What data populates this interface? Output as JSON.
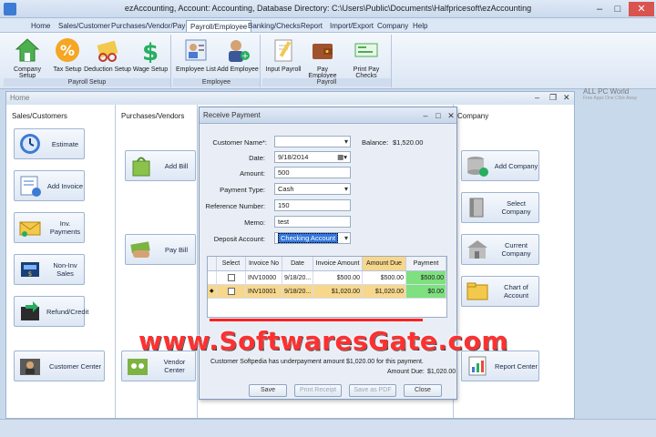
{
  "window": {
    "title": "ezAccounting, Account: Accounting, Database Directory: C:\\Users\\Public\\Documents\\Halfpricesoft\\ezAccounting"
  },
  "menu": [
    "Home",
    "Sales/Customer",
    "Purchases/Vendor/Pay Bill",
    "Payroll/Employee",
    "Banking/Checks",
    "Report",
    "Import/Export",
    "Company",
    "Help"
  ],
  "ribbon": {
    "payroll_setup": {
      "label": "Payroll Setup",
      "buttons": [
        "Company Setup",
        "Tax Setup",
        "Deduction Setup",
        "Wage Setup"
      ]
    },
    "employee": {
      "label": "Employee",
      "buttons": [
        "Employee List",
        "Add Employee"
      ]
    },
    "payroll": {
      "label": "Payroll",
      "buttons": [
        "Input Payroll",
        "Pay Employee",
        "Print Pay Checks"
      ]
    }
  },
  "watermark_site": {
    "line1": "ALL PC World",
    "line2": "Free Apps One Click Away"
  },
  "home": {
    "title": "Home",
    "sales_header": "Sales/Customers",
    "purchases_header": "Purchases/Vendors",
    "company_header": "Company",
    "sales_buttons": [
      "Estimate",
      "Add Invoice",
      "Inv. Payments",
      "Non-Inv Sales",
      "Refund/Credit",
      "Customer Center"
    ],
    "purchases_buttons": [
      "Add Bill",
      "Pay Bill",
      "Vendor Center"
    ],
    "company_buttons": [
      "Add Company",
      "Select Company",
      "Current Company",
      "Chart of Account",
      "Report Center"
    ]
  },
  "dialog": {
    "title": "Receive Payment",
    "customer_name_label": "Customer Name*:",
    "customer_name_value": "",
    "balance_label": "Balance:",
    "balance_value": "$1,520.00",
    "date_label": "Date:",
    "date_value": "9/18/2014",
    "amount_label": "Amount:",
    "amount_value": "500",
    "payment_type_label": "Payment Type:",
    "payment_type_value": "Cash",
    "reference_label": "Reference Number:",
    "reference_value": "150",
    "memo_label": "Memo:",
    "memo_value": "test",
    "deposit_label": "Deposit Account:",
    "deposit_value": "Checking Account",
    "grid": {
      "columns": [
        "Select",
        "Invoice No",
        "Date",
        "Invoice Amount",
        "Amount Due",
        "Payment"
      ],
      "rows": [
        {
          "invoice": "INV10000",
          "date": "9/18/20...",
          "invoice_amount": "$500.00",
          "amount_due": "$500.00",
          "payment": "$500.00"
        },
        {
          "invoice": "INV10001",
          "date": "9/18/20...",
          "invoice_amount": "$1,020.00",
          "amount_due": "$1,020.00",
          "payment": "$0.00"
        }
      ]
    },
    "message": "Customer Softpedia has underpayment amount $1,020.00 for this payment.",
    "amount_due_label": "Amount Due:",
    "amount_due_value": "$1,020.00",
    "buttons": {
      "save": "Save",
      "print_receipt": "Print Receipt",
      "save_pdf": "Save as PDF",
      "close": "Close"
    }
  },
  "banner": "www.SoftwaresGate.com"
}
